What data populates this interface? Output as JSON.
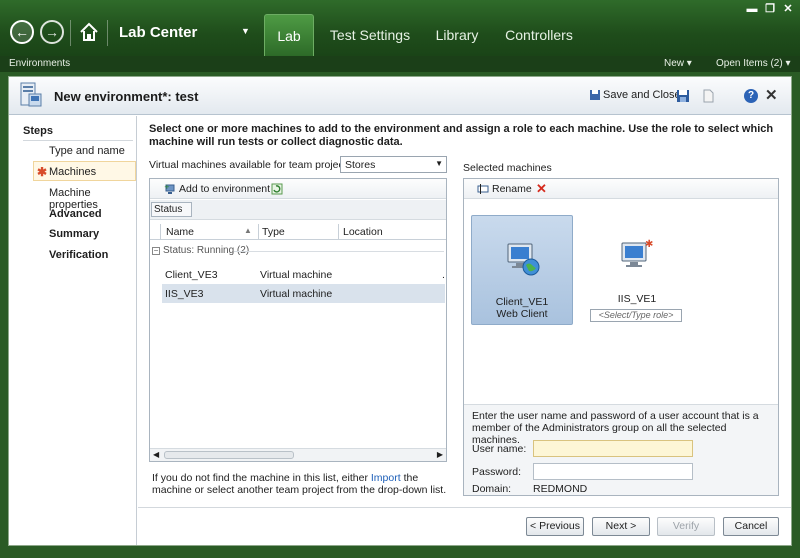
{
  "nav": {
    "app_title": "Lab Center",
    "tabs": [
      "Lab",
      "Test Settings",
      "Library",
      "Controllers"
    ],
    "active_tab": "Lab",
    "breadcrumb": "Environments",
    "new_label": "New",
    "open_items_label": "Open Items (2)"
  },
  "header": {
    "title": "New environment*: test",
    "save_close_label": "Save and Close"
  },
  "steps": {
    "title": "Steps",
    "items": [
      {
        "label": "Type and name",
        "bold": false
      },
      {
        "label": "Machines",
        "bold": false,
        "selected": true
      },
      {
        "label": "Machine properties",
        "bold": false
      },
      {
        "label": "Advanced",
        "bold": true
      },
      {
        "label": "Summary",
        "bold": true
      },
      {
        "label": "Verification",
        "bold": true
      }
    ]
  },
  "main": {
    "instruction": "Select one or more machines to add to the environment and assign a role to each machine. Use the role to select which machine will run tests or collect diagnostic data.",
    "vm_label": "Virtual machines available for team project:",
    "project_selected": "Stores",
    "add_env_label": "Add to environment",
    "group_chip": "Status",
    "columns": [
      "Name",
      "Type",
      "Location"
    ],
    "group_header": "Status: Running (2)",
    "rows": [
      {
        "name": "Client_VE3",
        "type": "Virtual machine",
        "location": "."
      },
      {
        "name": "IIS_VE3",
        "type": "Virtual machine",
        "location": ""
      }
    ],
    "hint_before": "If you do not find the machine in this list, either",
    "hint_link": "Import",
    "hint_after": "the machine or select another team project from the drop-down list."
  },
  "selected": {
    "label": "Selected machines",
    "rename_label": "Rename",
    "machines": [
      {
        "name": "Client_VE1",
        "role": "Web Client"
      },
      {
        "name": "IIS_VE1",
        "role_placeholder": "<Select/Type role>"
      }
    ],
    "cred_text": "Enter the user name and password of a user account that is a member of the Administrators group on all the selected machines.",
    "user_label": "User name:",
    "user_value": "",
    "password_label": "Password:",
    "password_value": "",
    "domain_label": "Domain:",
    "domain_value": "REDMOND"
  },
  "buttons": {
    "previous": "< Previous",
    "next": "Next >",
    "verify": "Verify",
    "cancel": "Cancel"
  },
  "colors": {
    "chrome_green": "#2f6b2a",
    "selection_blue": "#a9c2de",
    "link": "#1d5fb8"
  }
}
